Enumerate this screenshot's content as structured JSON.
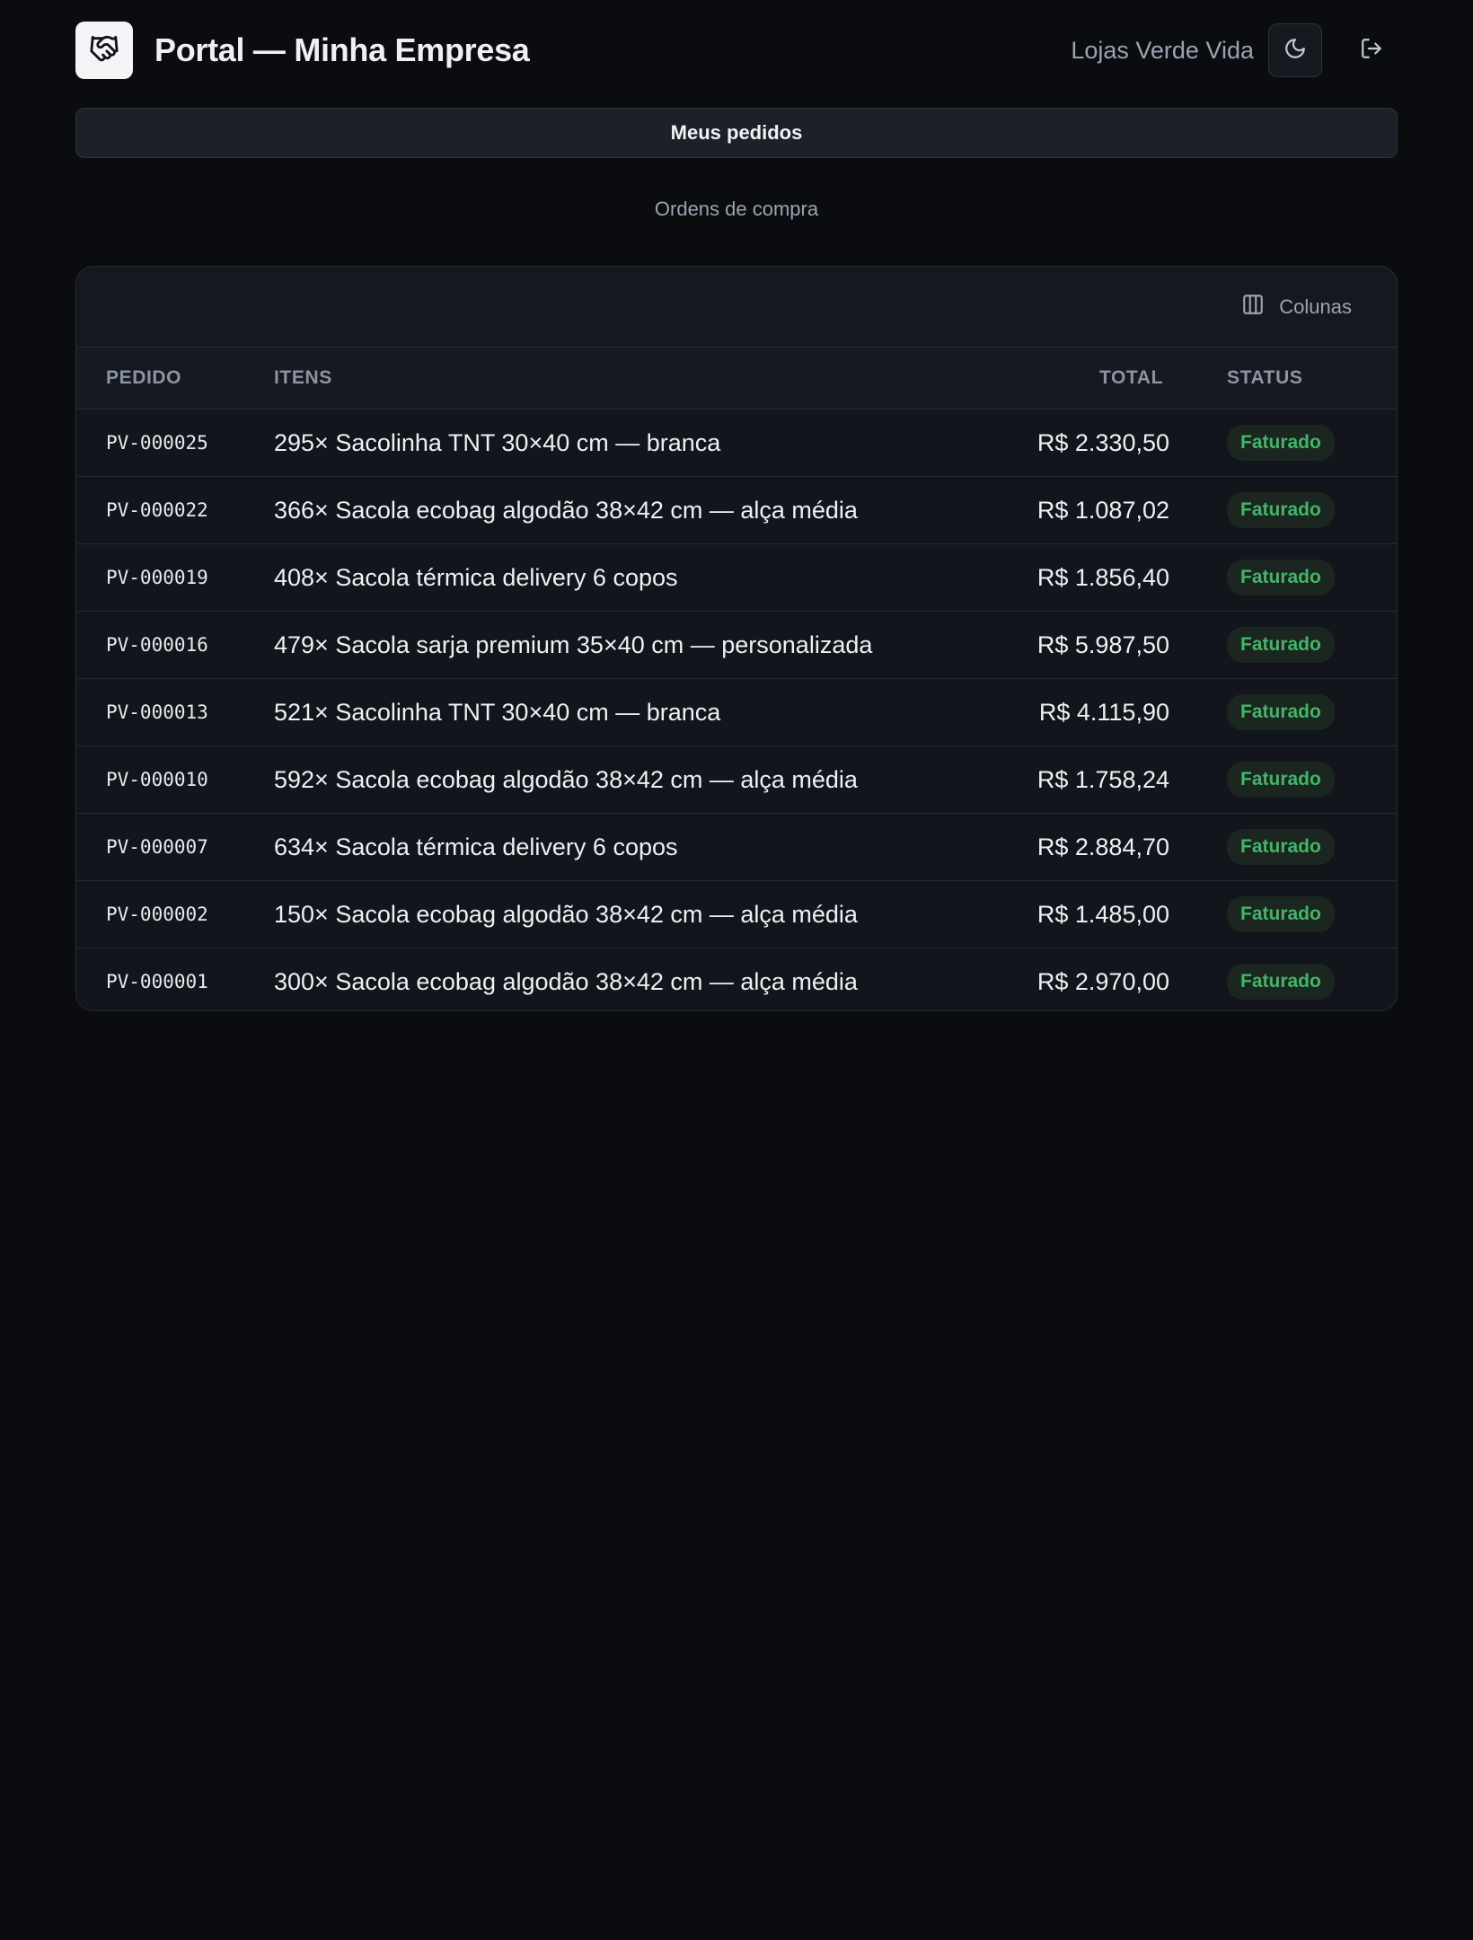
{
  "header": {
    "app_title": "Portal — Minha Empresa",
    "company_name": "Lojas Verde Vida"
  },
  "tabs": [
    {
      "label": "Meus pedidos"
    }
  ],
  "page": {
    "subtitle": "Ordens de compra"
  },
  "toolbar": {
    "columns_label": "Colunas"
  },
  "table": {
    "headers": {
      "id": "PEDIDO",
      "items": "ITENS",
      "total": "TOTAL",
      "status": "STATUS"
    },
    "rows": [
      {
        "id": "PV-000025",
        "items": "295× Sacolinha TNT 30×40 cm — branca",
        "total": "R$ 2.330,50",
        "status": "Faturado"
      },
      {
        "id": "PV-000022",
        "items": "366× Sacola ecobag algodão 38×42 cm — alça média",
        "total": "R$ 1.087,02",
        "status": "Faturado"
      },
      {
        "id": "PV-000019",
        "items": "408× Sacola térmica delivery 6 copos",
        "total": "R$ 1.856,40",
        "status": "Faturado"
      },
      {
        "id": "PV-000016",
        "items": "479× Sacola sarja premium 35×40 cm — personalizada",
        "total": "R$ 5.987,50",
        "status": "Faturado"
      },
      {
        "id": "PV-000013",
        "items": "521× Sacolinha TNT 30×40 cm — branca",
        "total": "R$ 4.115,90",
        "status": "Faturado"
      },
      {
        "id": "PV-000010",
        "items": "592× Sacola ecobag algodão 38×42 cm — alça média",
        "total": "R$ 1.758,24",
        "status": "Faturado"
      },
      {
        "id": "PV-000007",
        "items": "634× Sacola térmica delivery 6 copos",
        "total": "R$ 2.884,70",
        "status": "Faturado"
      },
      {
        "id": "PV-000002",
        "items": "150× Sacola ecobag algodão 38×42 cm — alça média",
        "total": "R$ 1.485,00",
        "status": "Faturado"
      },
      {
        "id": "PV-000001",
        "items": "300× Sacola ecobag algodão 38×42 cm — alça média",
        "total": "R$ 2.970,00",
        "status": "Faturado"
      }
    ]
  },
  "icons": {
    "logo": "handshake-icon",
    "theme_toggle": "moon-icon",
    "logout": "logout-icon",
    "columns": "columns-icon"
  },
  "colors": {
    "background": "#0b0c10",
    "card": "#15181f",
    "status_faturado_text": "#3fb866",
    "status_faturado_bg": "#1b2620"
  }
}
